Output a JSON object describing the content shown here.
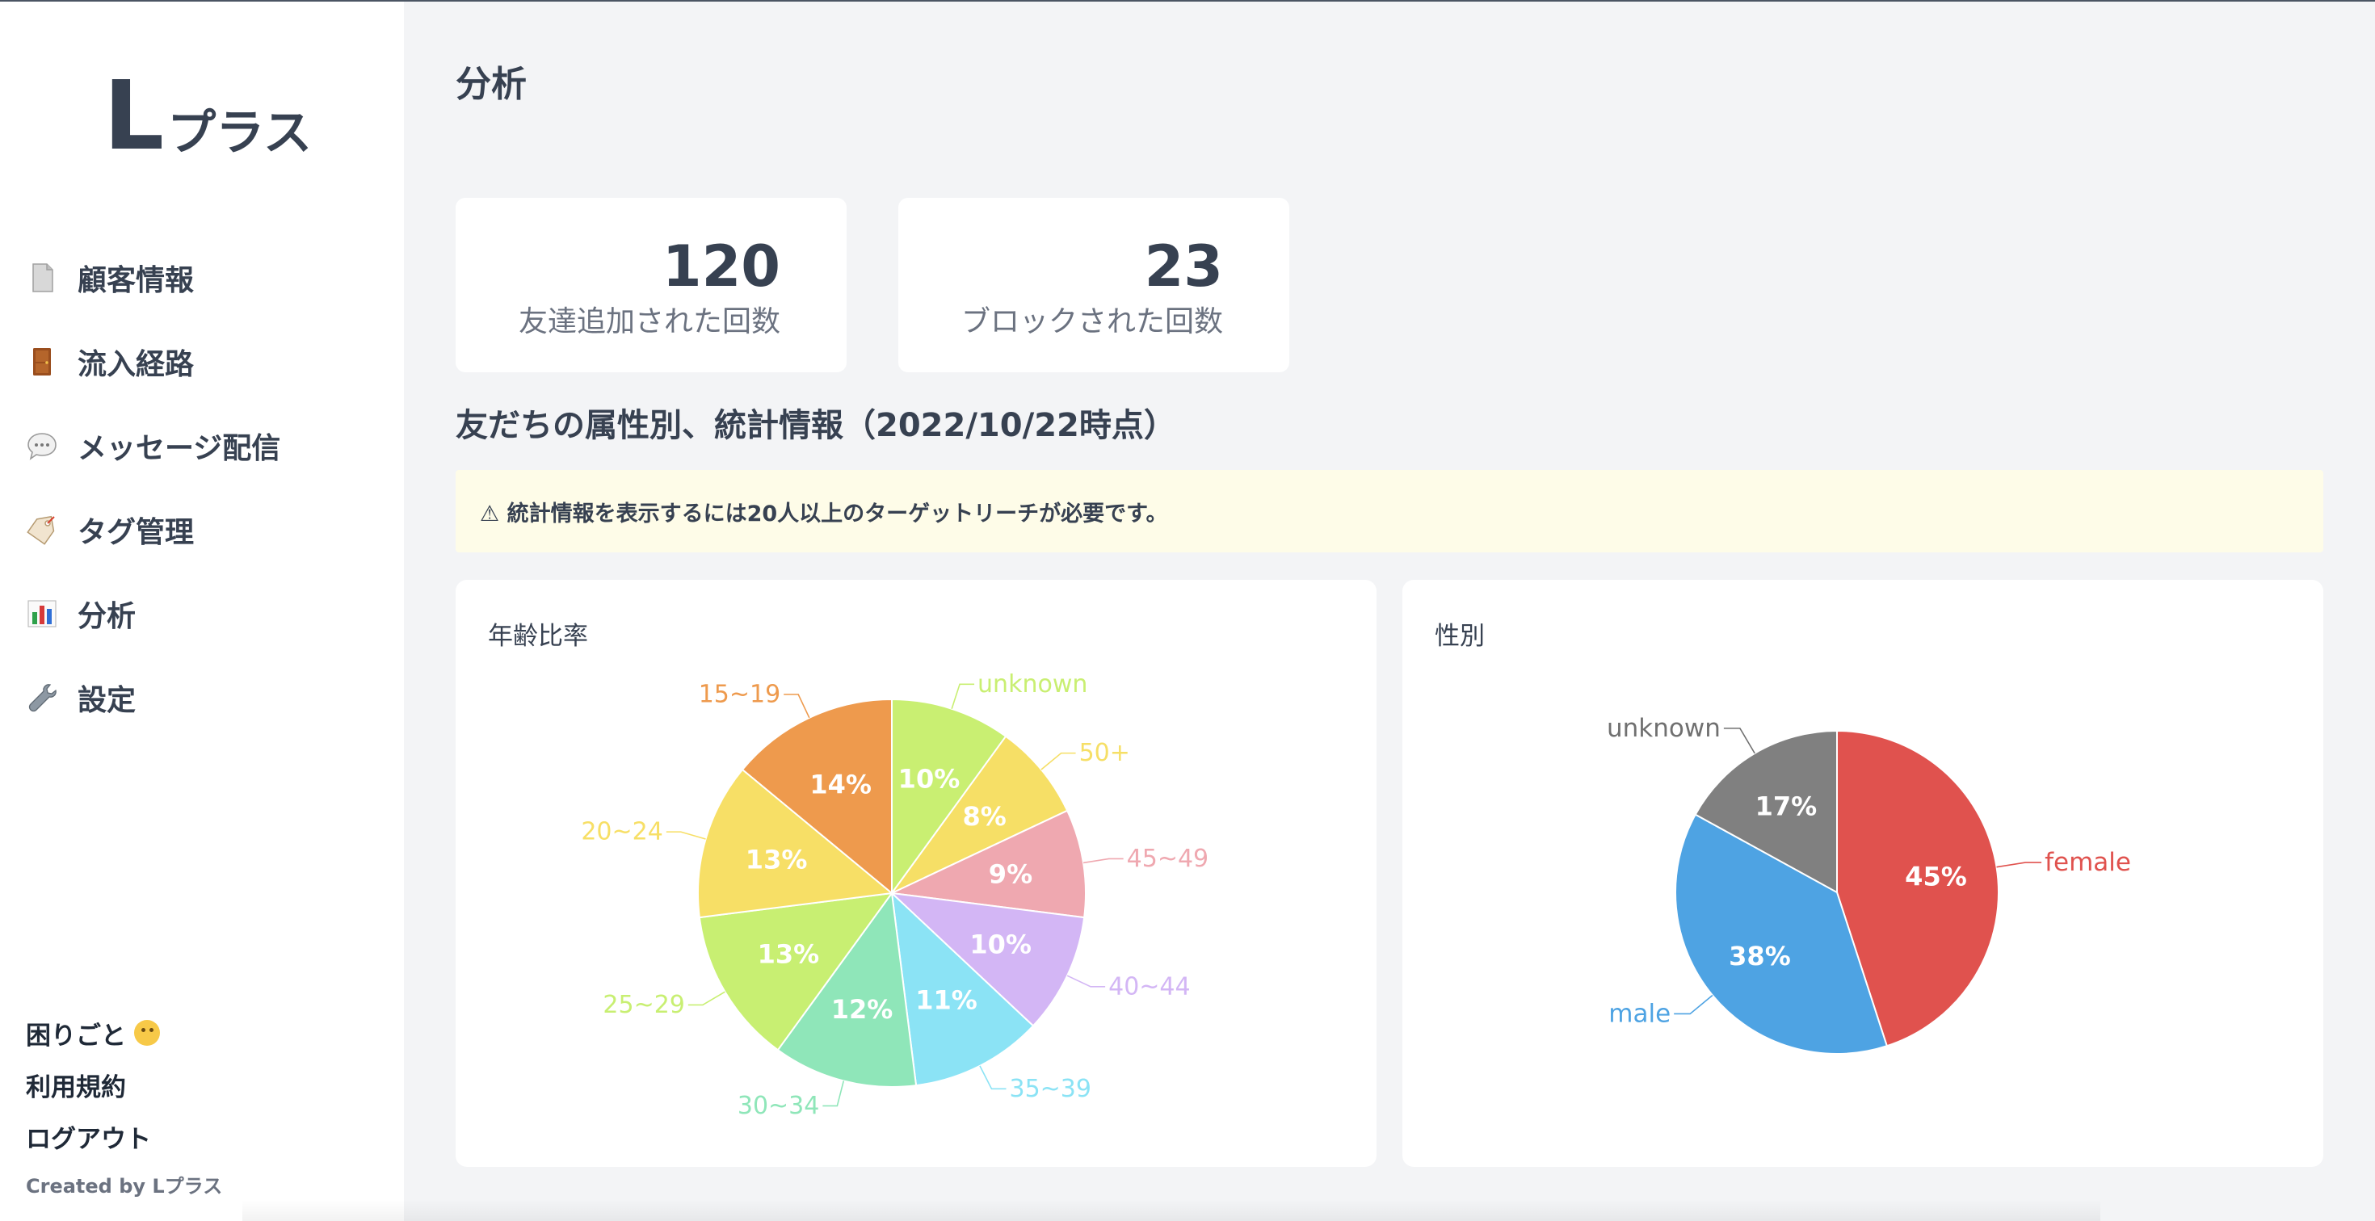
{
  "sidebar": {
    "logo": {
      "big": "L",
      "small": "プラス"
    },
    "nav": [
      {
        "label": "顧客情報",
        "icon": "document-icon"
      },
      {
        "label": "流入経路",
        "icon": "door-icon"
      },
      {
        "label": "メッセージ配信",
        "icon": "speech-bubble-icon"
      },
      {
        "label": "タグ管理",
        "icon": "tag-icon"
      },
      {
        "label": "分析",
        "icon": "bar-chart-icon"
      },
      {
        "label": "設定",
        "icon": "wrench-icon"
      }
    ],
    "footer": {
      "help": "困りごと",
      "terms": "利用規約",
      "logout": "ログアウト",
      "created_by": "Created by Lプラス"
    }
  },
  "main": {
    "title": "分析",
    "stats": [
      {
        "value": "120",
        "label": "友達追加された回数"
      },
      {
        "value": "23",
        "label": "ブロックされた回数"
      }
    ],
    "section_title": "友だちの属性別、統計情報（2022/10/22時点）",
    "notice": "⚠ 統計情報を表示するには20人以上のターゲットリーチが必要です。"
  },
  "chart_data": [
    {
      "type": "pie",
      "title": "年齢比率",
      "categories": [
        "unknown",
        "50+",
        "45~49",
        "40~44",
        "35~39",
        "30~34",
        "25~29",
        "20~24",
        "15~19"
      ],
      "values": [
        10,
        8,
        9,
        10,
        11,
        12,
        13,
        13,
        14
      ],
      "labels": [
        "10%",
        "8%",
        "9%",
        "10%",
        "11%",
        "12%",
        "13%",
        "13%",
        "14%"
      ],
      "colors": [
        "#c9ef72",
        "#f6df66",
        "#efa8b0",
        "#d3b6f5",
        "#8be3f5",
        "#8fe6b9",
        "#c8ef72",
        "#f7df66",
        "#ee9a4d"
      ]
    },
    {
      "type": "pie",
      "title": "性別",
      "categories": [
        "female",
        "male",
        "unknown"
      ],
      "values": [
        45,
        38,
        17
      ],
      "labels": [
        "45%",
        "38%",
        "17%"
      ],
      "colors": [
        "#e0524e",
        "#4ea3e3",
        "#808080"
      ],
      "label_colors": [
        "#e0524e",
        "#4ea3e3",
        "#707070"
      ]
    }
  ]
}
